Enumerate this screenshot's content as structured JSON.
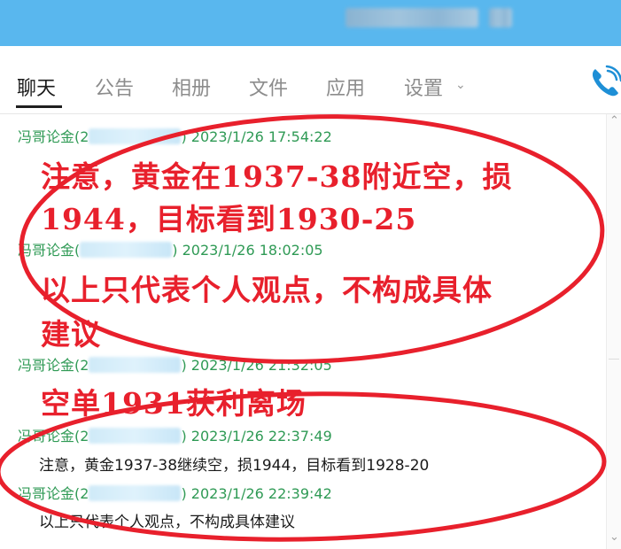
{
  "tabs": [
    {
      "label": "聊天",
      "active": true
    },
    {
      "label": "公告"
    },
    {
      "label": "相册"
    },
    {
      "label": "文件"
    },
    {
      "label": "应用"
    },
    {
      "label": "设置"
    }
  ],
  "messages": [
    {
      "sender": "冯哥论金(2",
      "sender_end": ")",
      "time": "2023/1/26 17:54:22"
    },
    {
      "sender": "冯哥论金(",
      "sender_end": ")",
      "time": "2023/1/26 18:02:05"
    },
    {
      "sender": "冯哥论金(2",
      "sender_end": ")",
      "time": "2023/1/26 21:32:05"
    },
    {
      "sender": "冯哥论金(2",
      "sender_end": ")",
      "time": "2023/1/26 22:37:49",
      "text": "注意，黄金1937-38继续空，损1944，目标看到1928-20"
    },
    {
      "sender": "冯哥论金(2",
      "sender_end": ")",
      "time": "2023/1/26 22:39:42",
      "text": "以上只代表个人观点，不构成具体建议"
    }
  ],
  "annotations": {
    "line1": "注意，黄金在1937-38附近空，损",
    "line2": "1944，目标看到1930-25",
    "line3": "以上只代表个人观点，不构成具体",
    "line4": "建议",
    "line5": "空单1931获利离场"
  },
  "colors": {
    "titlebar": "#59b7ee",
    "annotation_red": "#e8202c",
    "sender_green": "#2f9a55"
  }
}
